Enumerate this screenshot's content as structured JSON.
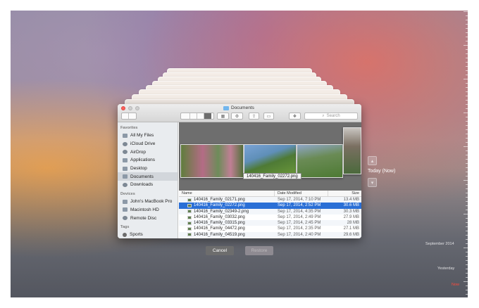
{
  "window": {
    "title": "Documents",
    "search_placeholder": "Search"
  },
  "sidebar": {
    "favorites_header": "Favorites",
    "favorites": [
      {
        "label": "All My Files",
        "icon": "all-files-icon"
      },
      {
        "label": "iCloud Drive",
        "icon": "cloud-icon"
      },
      {
        "label": "AirDrop",
        "icon": "airdrop-icon"
      },
      {
        "label": "Applications",
        "icon": "applications-icon"
      },
      {
        "label": "Desktop",
        "icon": "desktop-icon"
      },
      {
        "label": "Documents",
        "icon": "documents-icon",
        "selected": true
      },
      {
        "label": "Downloads",
        "icon": "downloads-icon"
      }
    ],
    "devices_header": "Devices",
    "devices": [
      {
        "label": "John's MacBook Pro",
        "icon": "laptop-icon"
      },
      {
        "label": "Macintosh HD",
        "icon": "hard-drive-icon"
      },
      {
        "label": "Remote Disc",
        "icon": "disc-icon"
      }
    ],
    "tags_header": "Tags",
    "tags": [
      {
        "label": "Sports",
        "icon": "tag-icon"
      }
    ]
  },
  "coverflow": {
    "caption": "140416_Family_02272.png"
  },
  "table": {
    "columns": {
      "name": "Name",
      "date": "Date Modified",
      "size": "Size"
    },
    "rows": [
      {
        "name": "140416_Family_02171.png",
        "date": "Sep 17, 2014, 7:10 PM",
        "size": "13.4 MB"
      },
      {
        "name": "140416_Family_02272.png",
        "date": "Sep 17, 2014, 2:52 PM",
        "size": "30.6 MB",
        "selected": true
      },
      {
        "name": "140416_Family_02349-2.png",
        "date": "Sep 17, 2014, 4:35 PM",
        "size": "30.3 MB"
      },
      {
        "name": "140416_Family_03032.png",
        "date": "Sep 17, 2014, 2:49 PM",
        "size": "27.9 MB"
      },
      {
        "name": "140416_Family_03315.png",
        "date": "Sep 17, 2014, 2:45 PM",
        "size": "28 MB"
      },
      {
        "name": "140416_Family_04472.png",
        "date": "Sep 17, 2014, 2:35 PM",
        "size": "27.1 MB"
      },
      {
        "name": "140416_Family_04519.png",
        "date": "Sep 17, 2014, 2:40 PM",
        "size": "29.6 MB"
      }
    ]
  },
  "buttons": {
    "cancel": "Cancel",
    "restore": "Restore"
  },
  "timemachine": {
    "current_label": "Today (Now)",
    "up_icon": "chevron-up-icon",
    "down_icon": "chevron-down-icon"
  },
  "timeline": {
    "september": "September 2014",
    "yesterday": "Yesterday",
    "now": "Now"
  },
  "colors": {
    "selection": "#2a6fd6",
    "now_marker": "#ff4a3c"
  }
}
